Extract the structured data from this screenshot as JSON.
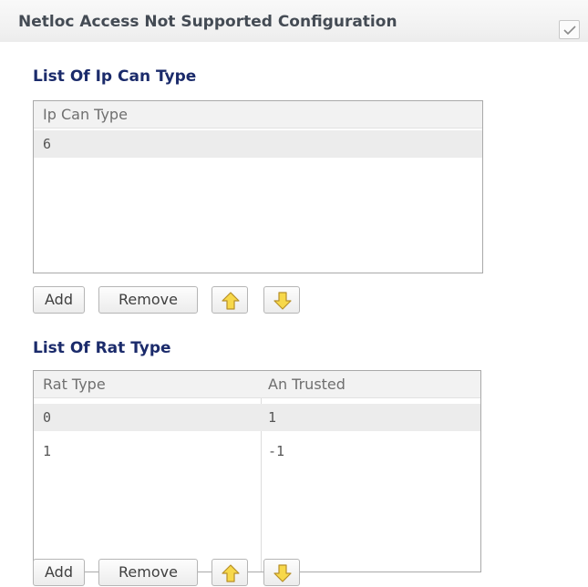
{
  "header": {
    "title": "Netloc Access Not Supported Configuration",
    "checkbox_checked": true
  },
  "ip_can_section": {
    "title": "List Of Ip Can Type",
    "columns": [
      "Ip Can Type"
    ],
    "rows": [
      [
        "6"
      ]
    ]
  },
  "rat_section": {
    "title": "List Of Rat Type",
    "columns": [
      "Rat Type",
      "An Trusted"
    ],
    "rows": [
      [
        "0",
        "1"
      ],
      [
        "1",
        "-1"
      ]
    ]
  },
  "toolbar": {
    "add_label": "Add",
    "remove_label": "Remove",
    "move_up_icon": "arrow-up-icon",
    "move_down_icon": "arrow-down-icon"
  },
  "colors": {
    "section_title": "#1b2b6b",
    "header_title": "#444b54",
    "arrow_fill": "#f7d84a",
    "arrow_stroke": "#b7902a"
  }
}
